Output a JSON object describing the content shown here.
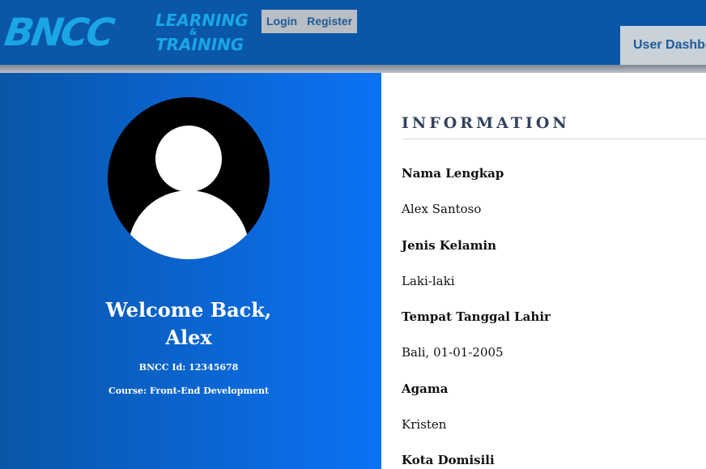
{
  "header": {
    "logo": {
      "main": "BNCC",
      "line1": "LEARNING",
      "amp": "&",
      "line2": "TRAINING"
    },
    "nav": {
      "login_label": "Login",
      "register_label": "Register"
    },
    "dashboard_tab_label": "User Dashboard"
  },
  "profile": {
    "welcome_line1": "Welcome Back,",
    "welcome_line2": "Alex",
    "bncc_id": "BNCC Id: 12345678",
    "course": "Course: Front-End Development"
  },
  "information": {
    "title": "INFORMATION",
    "fields": [
      {
        "label": "Nama Lengkap",
        "value": "Alex Santoso"
      },
      {
        "label": "Jenis Kelamin",
        "value": "Laki-laki"
      },
      {
        "label": "Tempat Tanggal Lahir",
        "value": "Bali, 01-01-2005"
      },
      {
        "label": "Agama",
        "value": "Kristen"
      },
      {
        "label": "Kota Domisili",
        "value": ""
      }
    ]
  },
  "colors": {
    "header_bg": "#0a56a8",
    "logo_blue": "#1aa6e6",
    "panel_gradient_start": "#0a56a8",
    "panel_gradient_end": "#0b72f5",
    "nav_text": "#1e5a98",
    "title_text": "#33425c"
  }
}
